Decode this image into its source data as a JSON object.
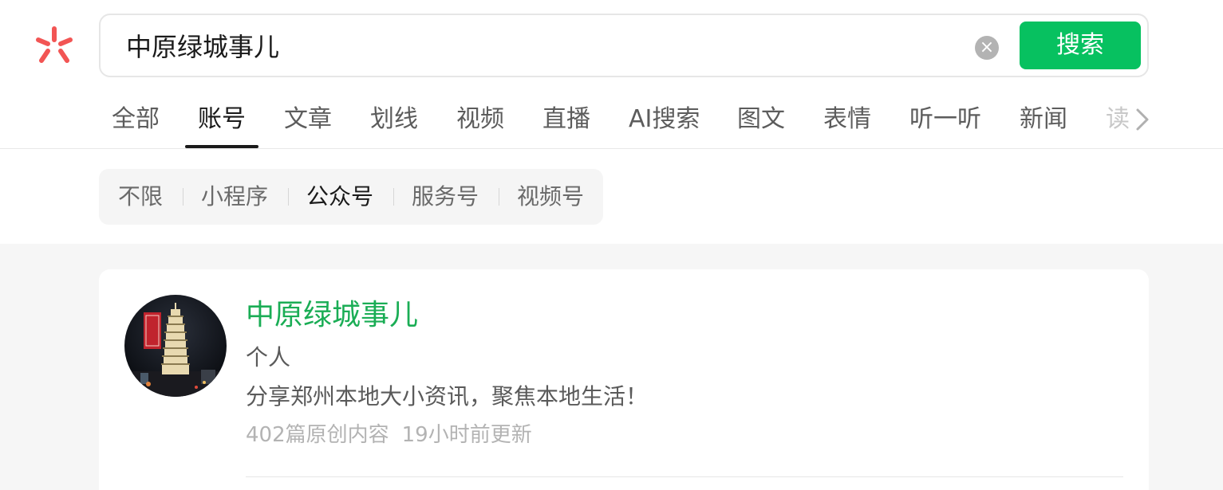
{
  "search": {
    "query": "中原绿城事儿",
    "button_label": "搜索",
    "clear_icon": "×"
  },
  "tabs": [
    {
      "label": "全部"
    },
    {
      "label": "账号"
    },
    {
      "label": "文章"
    },
    {
      "label": "划线"
    },
    {
      "label": "视频"
    },
    {
      "label": "直播"
    },
    {
      "label": "AI搜索"
    },
    {
      "label": "图文"
    },
    {
      "label": "表情"
    },
    {
      "label": "听一听"
    },
    {
      "label": "新闻"
    },
    {
      "label": "读"
    }
  ],
  "active_tab": "账号",
  "filters": [
    {
      "label": "不限"
    },
    {
      "label": "小程序"
    },
    {
      "label": "公众号"
    },
    {
      "label": "服务号"
    },
    {
      "label": "视频号"
    }
  ],
  "active_filter": "公众号",
  "result": {
    "name": "中原绿城事儿",
    "type": "个人",
    "description": "分享郑州本地大小资讯，聚焦本地生活！",
    "original_count": "402篇原创内容",
    "updated": "19小时前更新",
    "avatar_icon": "tower-photo-avatar"
  },
  "colors": {
    "accent_green": "#07c160",
    "name_green": "#1aad55",
    "logo_red": "#f25554"
  }
}
